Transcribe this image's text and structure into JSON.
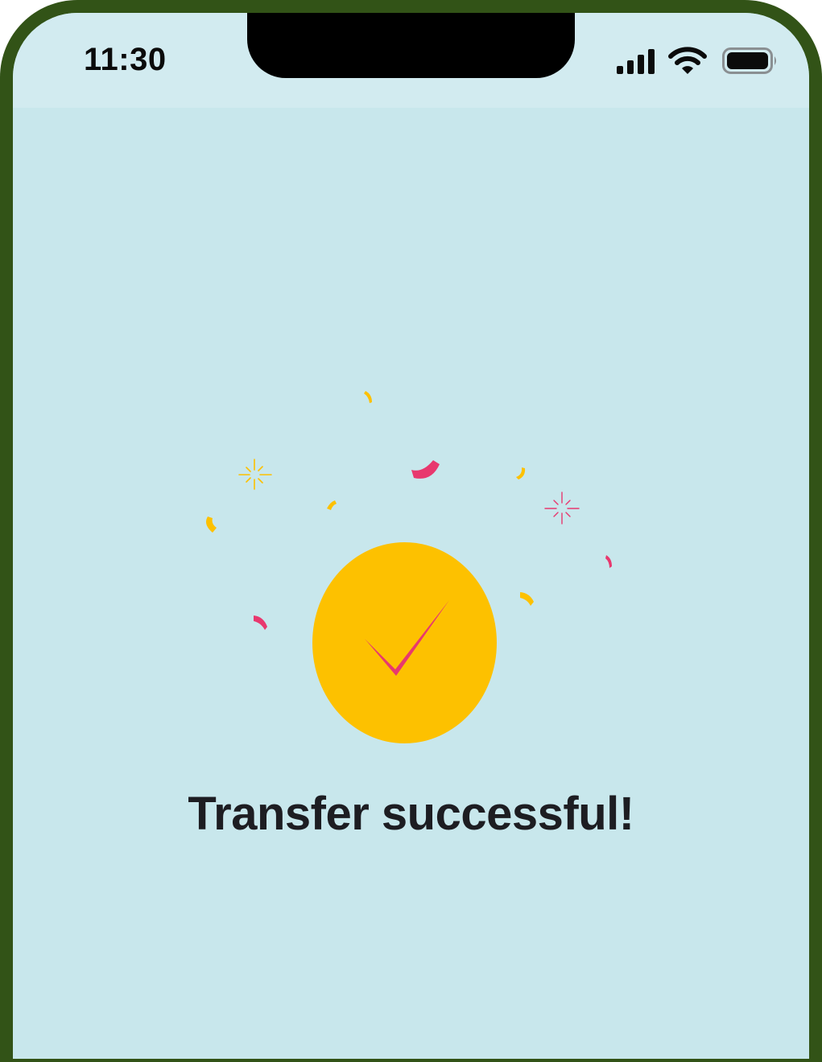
{
  "status_bar": {
    "time": "11:30",
    "icons": [
      "cellular-signal-icon",
      "wifi-icon",
      "battery-icon"
    ]
  },
  "main": {
    "title": "Transfer successful!",
    "icon": "checkmark-icon",
    "decoration": "confetti"
  },
  "colors": {
    "frame": "#325317",
    "background": "#c8e7ec",
    "status_bar_bg": "#d2ebf0",
    "accent_yellow": "#fdc100",
    "accent_pink": "#e8386e",
    "title_text": "#1d1d22"
  }
}
